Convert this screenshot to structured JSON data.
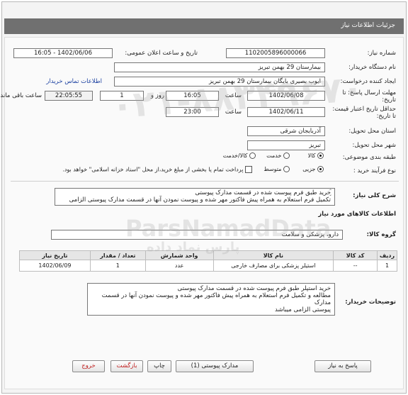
{
  "header": {
    "title": "جزئیات اطلاعات نیاز"
  },
  "form": {
    "need_number_label": "شماره نیاز:",
    "need_number": "1102005896000066",
    "announce_label": "تاریخ و ساعت اعلان عمومی:",
    "announce_value": "1402/06/06 - 16:05",
    "buyer_org_label": "نام دستگاه خریدار:",
    "buyer_org": "بیمارستان 29 بهمن تبریز",
    "creator_label": "ایجاد کننده درخواست:",
    "creator": "ایوب بصیری  بایگان بیمارستان 29 بهمن تبریز",
    "contact_link": "اطلاعات تماس خریدار",
    "deadline_label": "مهلت ارسال پاسخ: تا تاریخ:",
    "deadline_date": "1402/06/08",
    "time_label": "ساعت",
    "deadline_time": "16:05",
    "days_value": "1",
    "days_label": "روز و",
    "remaining_time": "22:05:55",
    "remaining_label": "ساعت باقی مانده",
    "validity_label": "حداقل تاریخ اعتبار قیمت: تا تاریخ:",
    "validity_date": "1402/06/11",
    "validity_time_label": "ساعت",
    "validity_time": "23:00",
    "province_label": "استان محل تحویل:",
    "province": "آذربایجان شرقی",
    "city_label": "شهر محل تحویل:",
    "city": "تبریز",
    "category_label": "طبقه بندی موضوعی:",
    "category_options": [
      "کالا",
      "خدمت",
      "کالا/خدمت"
    ],
    "purchase_label": "نوع فرآیند خرید :",
    "purchase_options": [
      "جزیی",
      "متوسط"
    ],
    "payment_text": "پرداخت تمام یا بخشی از مبلغ خرید،از محل \"اسناد خزانه اسلامی\" خواهد بود.",
    "summary_label": "شرح کلی نیاز:",
    "summary_line1": "خرید طبق فرم پیوست شده در قسمت مدارک پیوستی",
    "summary_line2": "تکمیل فرم استعلام به همراه پیش فاکتور مهر شده و پیوست نمودن آنها در قسمت مدارک پیوستی الزامی"
  },
  "goods": {
    "section_title": "اطلاعات کالاهای مورد نیاز",
    "group_label": "گروه کالا:",
    "group_value": "دارو، پزشکی و سلامت",
    "columns": [
      "ردیف",
      "کد کالا",
      "نام کالا",
      "واحد شمارش",
      "تعداد / مقدار",
      "تاریخ نیاز"
    ],
    "rows": [
      {
        "index": "1",
        "code": "--",
        "name": "استیلر پزشکی برای مصارف خارجی",
        "unit": "عدد",
        "qty": "1",
        "date": "1402/06/09"
      }
    ],
    "buyer_notes_label": "توضیحات خریدار:",
    "buyer_notes_line1": "خرید استپلر طبق فرم پیوست شده در قسمت مدارک پیوستی",
    "buyer_notes_line2": "مطالعه و تکمیل فرم استعلام به همراه پیش فاکتور مهر شده و پیوست نمودن آنها در قسمت مدارک",
    "buyer_notes_line3": "پیوستی الزامی میباشد"
  },
  "buttons": {
    "reply": "پاسخ به نیاز",
    "attachments": "مدارک پیوستی (1)",
    "print": "چاپ",
    "back": "بازگشت",
    "exit": "خروج"
  },
  "watermark": {
    "brand": "ParsNamadData",
    "fa": "پارس نماد داده",
    "phone": "۰۲۱-۸۸۳۴۹۶۷۰"
  }
}
